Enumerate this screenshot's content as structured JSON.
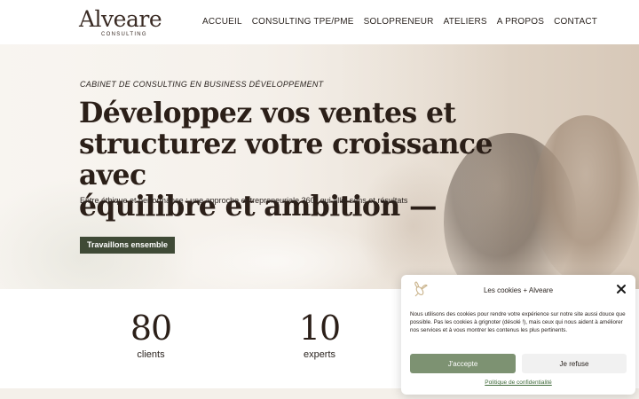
{
  "header": {
    "logo_word": "Alveare",
    "logo_sub": "CONSULTING",
    "nav": [
      {
        "label": "ACCUEIL"
      },
      {
        "label": "CONSULTING TPE/PME"
      },
      {
        "label": "SOLOPRENEUR"
      },
      {
        "label": "ATELIERS"
      },
      {
        "label": "A PROPOS"
      },
      {
        "label": "CONTACT"
      }
    ]
  },
  "hero": {
    "eyebrow": "CABINET DE CONSULTING EN BUSINESS DÉVELOPPEMENT",
    "headline_line1": "Développez vos ventes et",
    "headline_line2": "structurez votre croissance avec",
    "headline_line3": "équilibre et ambition —",
    "subline": "Entre éthique et performance : une approche entrepreneuriale 360° qui allie sens et résultats",
    "cta_label": "Travaillons ensemble"
  },
  "stats": [
    {
      "value": "80",
      "label": "clients"
    },
    {
      "value": "10",
      "label": "experts"
    }
  ],
  "cookie": {
    "title": "Les cookies + Alveare",
    "text": "Nous utilisons des cookies pour rendre votre expérience sur notre site aussi douce que possible. Pas les cookies à grignoter (désolé !), mais ceux qui nous aident à améliorer nos services et à vous montrer les contenus les plus pertinents.",
    "accept_label": "J'accepte",
    "refuse_label": "Je refuse",
    "policy_label": "Politique de confidentialité"
  },
  "colors": {
    "cta_bg": "#3f4a36",
    "accept_bg": "#7d9272",
    "text_dark": "#2b1f18"
  },
  "icons": [
    "bee-logo-icon",
    "close-icon"
  ]
}
